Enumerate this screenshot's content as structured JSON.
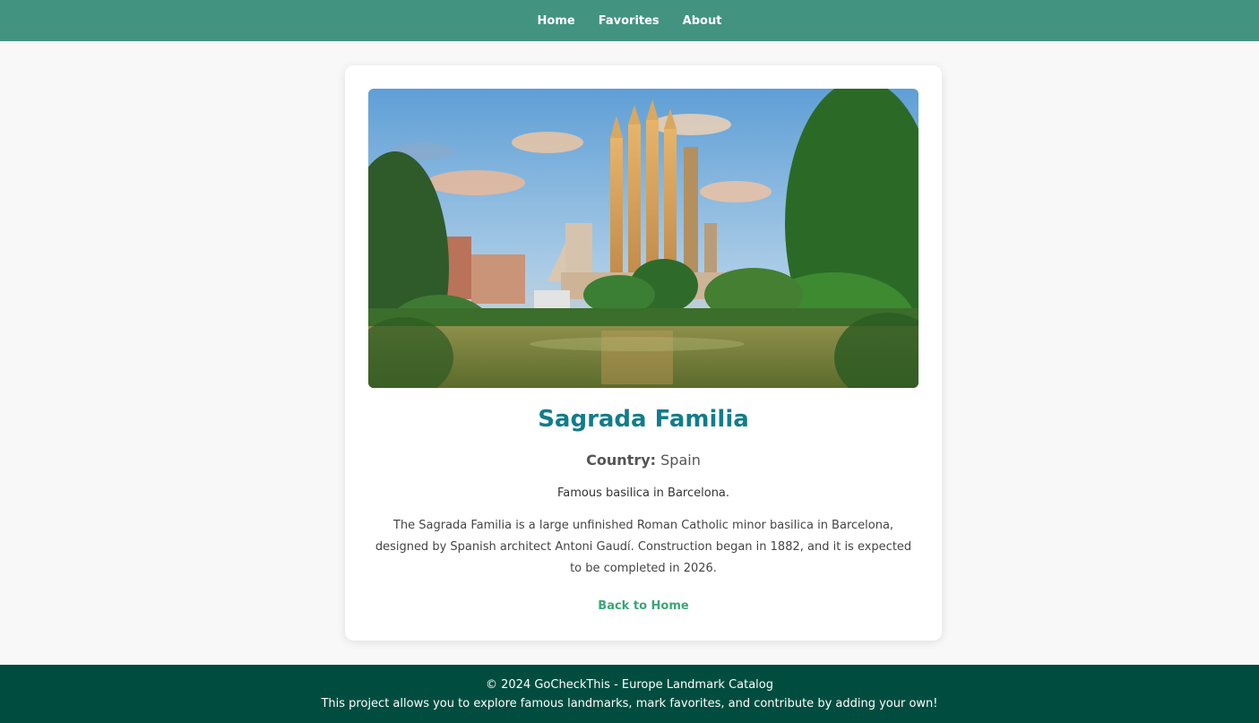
{
  "nav": {
    "home": "Home",
    "favorites": "Favorites",
    "about": "About"
  },
  "landmark": {
    "image_alt": "Sagrada Familia",
    "title": "Sagrada Familia",
    "country_label": "Country:",
    "country": "Spain",
    "short_description": "Famous basilica in Barcelona.",
    "long_description": "The Sagrada Familia is a large unfinished Roman Catholic minor basilica in Barcelona, designed by Spanish architect Antoni Gaudí. Construction began in 1882, and it is expected to be completed in 2026.",
    "back_link": "Back to Home"
  },
  "footer": {
    "line1": "© 2024 GoCheckThis - Europe Landmark Catalog",
    "line2": "This project allows you to explore famous landmarks, mark favorites, and contribute by adding your own!"
  },
  "colors": {
    "navbar": "#439381",
    "title": "#137c8a",
    "link": "#3aa676",
    "footer": "#004d40"
  }
}
